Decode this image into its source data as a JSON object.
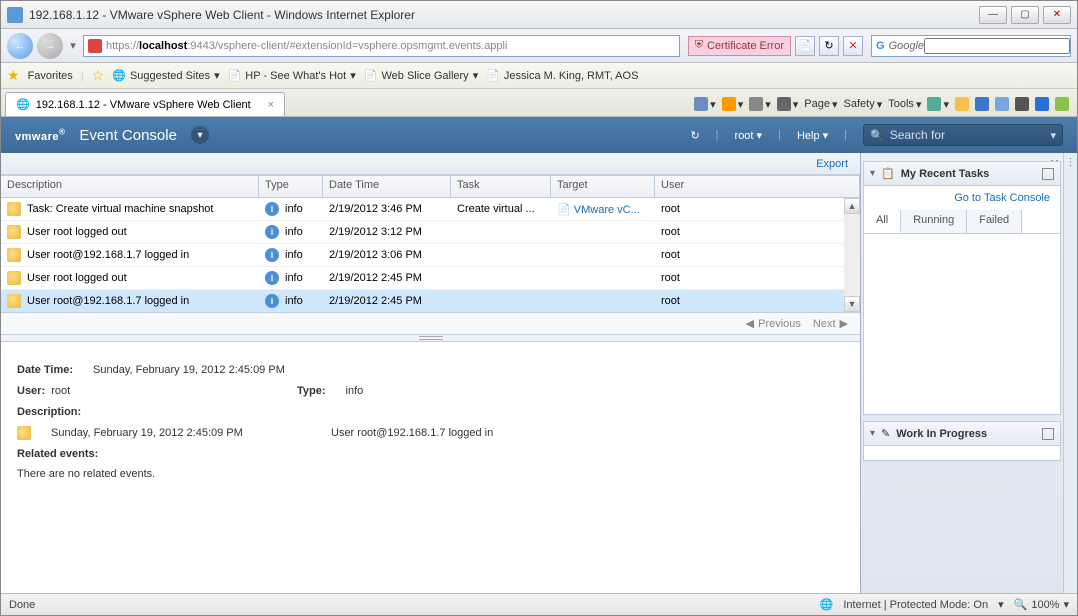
{
  "window": {
    "title": "192.168.1.12 - VMware vSphere Web Client - Windows Internet Explorer",
    "min": "—",
    "max": "▢",
    "close": "✕"
  },
  "nav": {
    "back": "←",
    "fwd": "→",
    "addr_prefix": "https://",
    "addr_host": "localhost",
    "addr_path": ":9443/vsphere-client/#extensionId=vsphere.opsmgmt.events.appli",
    "cert_error": "Certificate Error",
    "refresh": "↻",
    "stop": "✕",
    "search_engine": "Google",
    "search_value": ""
  },
  "fav": {
    "favorites": "Favorites",
    "suggested": "Suggested Sites",
    "hp": "HP - See What's Hot",
    "webslice": "Web Slice Gallery",
    "jessica": "Jessica M. King, RMT, AOS"
  },
  "tab": {
    "label": "192.168.1.12 - VMware vSphere Web Client",
    "page": "Page",
    "safety": "Safety",
    "tools": "Tools"
  },
  "vm": {
    "logo": "vmware",
    "title": "Event Console",
    "refresh": "↻",
    "user": "root",
    "help": "Help",
    "search_placeholder": "Search for",
    "export": "Export"
  },
  "cols": {
    "desc": "Description",
    "type": "Type",
    "dt": "Date Time",
    "task": "Task",
    "target": "Target",
    "user": "User"
  },
  "rows": [
    {
      "desc": "Task: Create virtual machine snapshot",
      "type": "info",
      "dt": "2/19/2012 3:46 PM",
      "task": "Create virtual ...",
      "target": "VMware vC...",
      "user": "root"
    },
    {
      "desc": "User root logged out",
      "type": "info",
      "dt": "2/19/2012 3:12 PM",
      "task": "",
      "target": "",
      "user": "root"
    },
    {
      "desc": "User root@192.168.1.7 logged in",
      "type": "info",
      "dt": "2/19/2012 3:06 PM",
      "task": "",
      "target": "",
      "user": "root"
    },
    {
      "desc": "User root logged out",
      "type": "info",
      "dt": "2/19/2012 2:45 PM",
      "task": "",
      "target": "",
      "user": "root"
    },
    {
      "desc": "User root@192.168.1.7 logged in",
      "type": "info",
      "dt": "2/19/2012 2:45 PM",
      "task": "",
      "target": "",
      "user": "root"
    }
  ],
  "pager": {
    "prev": "Previous",
    "next": "Next"
  },
  "detail": {
    "dt_label": "Date Time:",
    "dt_val": "Sunday, February 19, 2012 2:45:09 PM",
    "user_label": "User:",
    "user_val": "root",
    "type_label": "Type:",
    "type_val": "info",
    "desc_label": "Description:",
    "desc_dt": "Sunday, February 19, 2012 2:45:09 PM",
    "desc_msg": "User root@192.168.1.7 logged in",
    "related_label": "Related events:",
    "related_none": "There are no related events."
  },
  "rpanel": {
    "tasks_title": "My Recent Tasks",
    "task_console": "Go to Task Console",
    "tab_all": "All",
    "tab_running": "Running",
    "tab_failed": "Failed",
    "wip_title": "Work In Progress"
  },
  "status": {
    "done": "Done",
    "zone": "Internet | Protected Mode: On",
    "zoom": "100%"
  }
}
